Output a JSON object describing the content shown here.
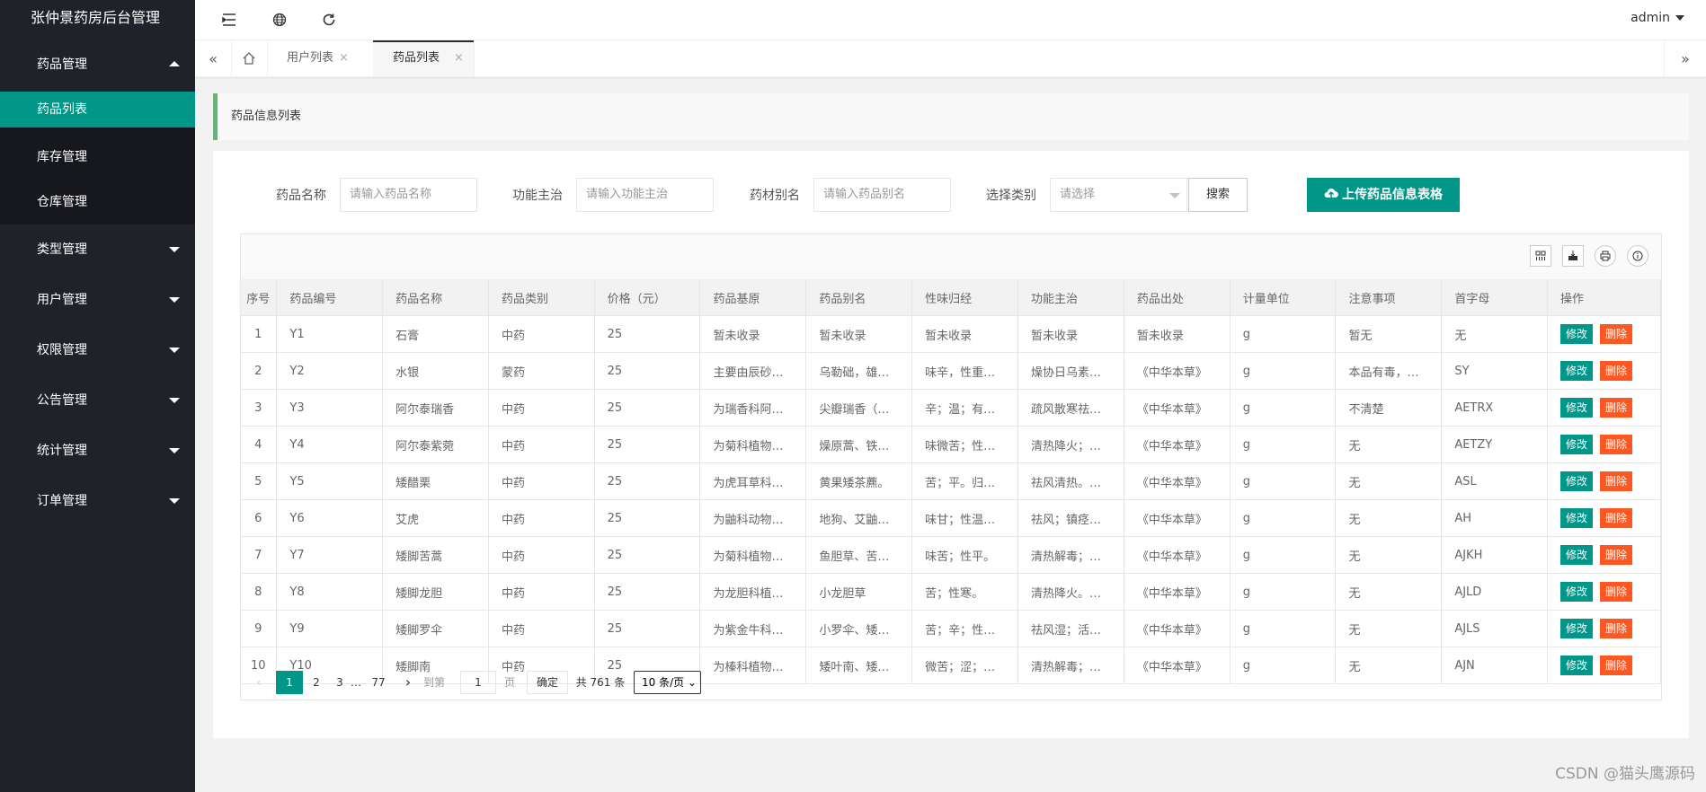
{
  "app": {
    "title": "张仲景药房后台管理"
  },
  "sidebar": {
    "groups": [
      {
        "label": "药品管理",
        "expanded": true,
        "items": [
          "药品列表",
          "库存管理",
          "仓库管理"
        ],
        "active": "药品列表"
      },
      {
        "label": "类型管理"
      },
      {
        "label": "用户管理"
      },
      {
        "label": "权限管理"
      },
      {
        "label": "公告管理"
      },
      {
        "label": "统计管理"
      },
      {
        "label": "订单管理"
      }
    ]
  },
  "header": {
    "user": "admin"
  },
  "tabs": [
    {
      "label": "用户列表",
      "active": false
    },
    {
      "label": "药品列表",
      "active": true
    }
  ],
  "breadcrumb": "药品信息列表",
  "search": {
    "name_label": "药品名称",
    "name_placeholder": "请输入药品名称",
    "func_label": "功能主治",
    "func_placeholder": "请输入功能主治",
    "alias_label": "药材别名",
    "alias_placeholder": "请输入药品别名",
    "type_label": "选择类别",
    "type_placeholder": "请选择",
    "search_button": "搜索",
    "upload_button": "上传药品信息表格"
  },
  "table": {
    "columns": [
      "序号",
      "药品编号",
      "药品名称",
      "药品类别",
      "价格（元）",
      "药品基原",
      "药品别名",
      "性味归经",
      "功能主治",
      "药品出处",
      "计量单位",
      "注意事项",
      "首字母",
      "操作"
    ],
    "edit_label": "修改",
    "delete_label": "删除",
    "rows": [
      [
        "1",
        "Y1",
        "石膏",
        "中药",
        "25",
        "暂未收录",
        "暂未收录",
        "暂未收录",
        "暂未收录",
        "暂未收录",
        "g",
        "暂无",
        "无"
      ],
      [
        "2",
        "Y2",
        "水银",
        "蒙药",
        "25",
        "主要由辰砂…",
        "乌勒础，雄…",
        "味辛，性重…",
        "燥协日乌素…",
        "《中华本草》",
        "g",
        "本品有毒，…",
        "SY"
      ],
      [
        "3",
        "Y3",
        "阿尔泰瑞香",
        "中药",
        "25",
        "为瑞香科阿…",
        "尖瓣瑞香（…",
        "辛；温；有…",
        "疏风散寒祛…",
        "《中华本草》",
        "g",
        "不清楚",
        "AETRX"
      ],
      [
        "4",
        "Y4",
        "阿尔泰紫菀",
        "中药",
        "25",
        "为菊科植物…",
        "燥原蒿、铁…",
        "味微苦；性…",
        "清热降火；…",
        "《中华本草》",
        "g",
        "无",
        "AETZY"
      ],
      [
        "5",
        "Y5",
        "矮醋栗",
        "中药",
        "25",
        "为虎耳草科…",
        "黄果矮茶藨。",
        "苦；平。归…",
        "祛风清热。…",
        "《中华本草》",
        "g",
        "无",
        "ASL"
      ],
      [
        "6",
        "Y6",
        "艾虎",
        "中药",
        "25",
        "为鼬科动物…",
        "地狗、艾鼬…",
        "味甘；性温…",
        "祛风；镇痉…",
        "《中华本草》",
        "g",
        "无",
        "AH"
      ],
      [
        "7",
        "Y7",
        "矮脚苦蒿",
        "中药",
        "25",
        "为菊科植物…",
        "鱼胆草、苦…",
        "味苦；性平。",
        "清热解毒；…",
        "《中华本草》",
        "g",
        "无",
        "AJKH"
      ],
      [
        "8",
        "Y8",
        "矮脚龙胆",
        "中药",
        "25",
        "为龙胆科植…",
        "小龙胆草",
        "苦；性寒。",
        "清热降火。…",
        "《中华本草》",
        "g",
        "无",
        "AJLD"
      ],
      [
        "9",
        "Y9",
        "矮脚罗伞",
        "中药",
        "25",
        "为紫金牛科…",
        "小罗伞、矮…",
        "苦；辛；性…",
        "祛风湿；活…",
        "《中华本草》",
        "g",
        "无",
        "AJLS"
      ],
      [
        "10",
        "Y10",
        "矮脚南",
        "中药",
        "25",
        "为榛科植物…",
        "矮叶南、矮…",
        "微苦；涩；…",
        "清热解毒；…",
        "《中华本草》",
        "g",
        "无",
        "AJN"
      ]
    ]
  },
  "pager": {
    "pages": [
      "1",
      "2",
      "3",
      "…",
      "77"
    ],
    "current": "1",
    "goto_label": "到第",
    "goto_value": "1",
    "page_unit": "页",
    "confirm": "确定",
    "total": "共 761 条",
    "page_size": "10 条/页"
  },
  "watermark": "CSDN @猫头鹰源码"
}
